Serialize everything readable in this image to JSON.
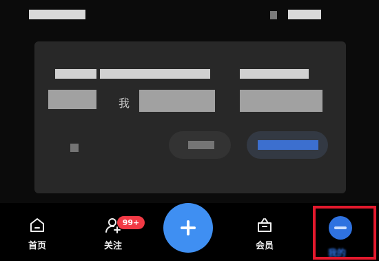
{
  "colors": {
    "background": "#0b0b0b",
    "add_button": "#3f8ff2",
    "badge": "#f23a45",
    "highlight": "#e3192d",
    "active_tab": "#2f72e0"
  },
  "dialog": {
    "visible_word": "我"
  },
  "nav": {
    "items": [
      {
        "label": "首页",
        "icon": "home-icon"
      },
      {
        "label": "关注",
        "icon": "follow-icon",
        "badge": "99+"
      },
      {
        "label": "",
        "icon": "plus-icon"
      },
      {
        "label": "会员",
        "icon": "vip-icon"
      },
      {
        "label": "我的",
        "icon": "profile-icon"
      }
    ]
  }
}
